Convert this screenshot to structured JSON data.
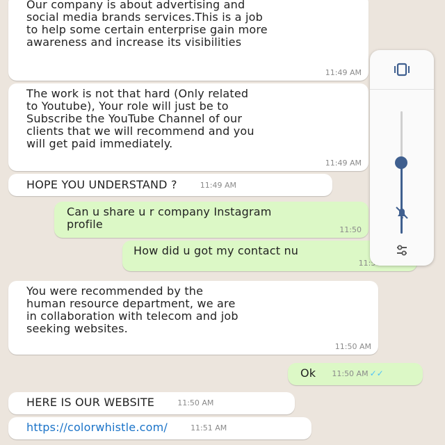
{
  "messages": [
    {
      "id": "m1",
      "dir": "in",
      "text": "Our company is about advertising and\nsocial media brands services.This is a job\nto help some certain enterprise gain more\nawareness and increase its visibilities",
      "time": "11:49 AM"
    },
    {
      "id": "m2",
      "dir": "in",
      "text": "The work is not that hard (Only related\nto Youtube), Your role will just be to\nSubscribe the YouTube Channel of our\nclients that we will recommend and you\nwill get paid immediately.",
      "time": "11:49 AM"
    },
    {
      "id": "m3",
      "dir": "in",
      "text": "HOPE YOU UNDERSTAND ?",
      "time": "11:49 AM"
    },
    {
      "id": "m4",
      "dir": "out",
      "text": "Can u share u r company Instagram\nprofile",
      "time": "11:50"
    },
    {
      "id": "m5",
      "dir": "out",
      "text": "How did u got my contact nu",
      "time": "11:50 AM"
    },
    {
      "id": "m6",
      "dir": "in",
      "text": "You were recommended by the\nhuman resource department, we are\nin collaboration with telecom and job\nseeking websites.",
      "time": "11:50 AM"
    },
    {
      "id": "m7",
      "dir": "out",
      "text": "Ok",
      "time": "11:50 AM"
    },
    {
      "id": "m8",
      "dir": "in",
      "text": "HERE IS OUR WEBSITE",
      "time": "11:50 AM"
    },
    {
      "id": "m9",
      "dir": "in",
      "text": "https://colorwhistle.com/",
      "time": "11:51 AM"
    }
  ],
  "volume_panel": {
    "level": 0.58,
    "icons": [
      "vibrate-icon",
      "mute-bell-icon",
      "settings-icon"
    ]
  },
  "colors": {
    "background": "#ece5dd",
    "incoming": "#ffffff",
    "outgoing": "#dcf8c6",
    "read_ticks": "#4fc3f7",
    "slider_accent": "#3f5f8f"
  }
}
